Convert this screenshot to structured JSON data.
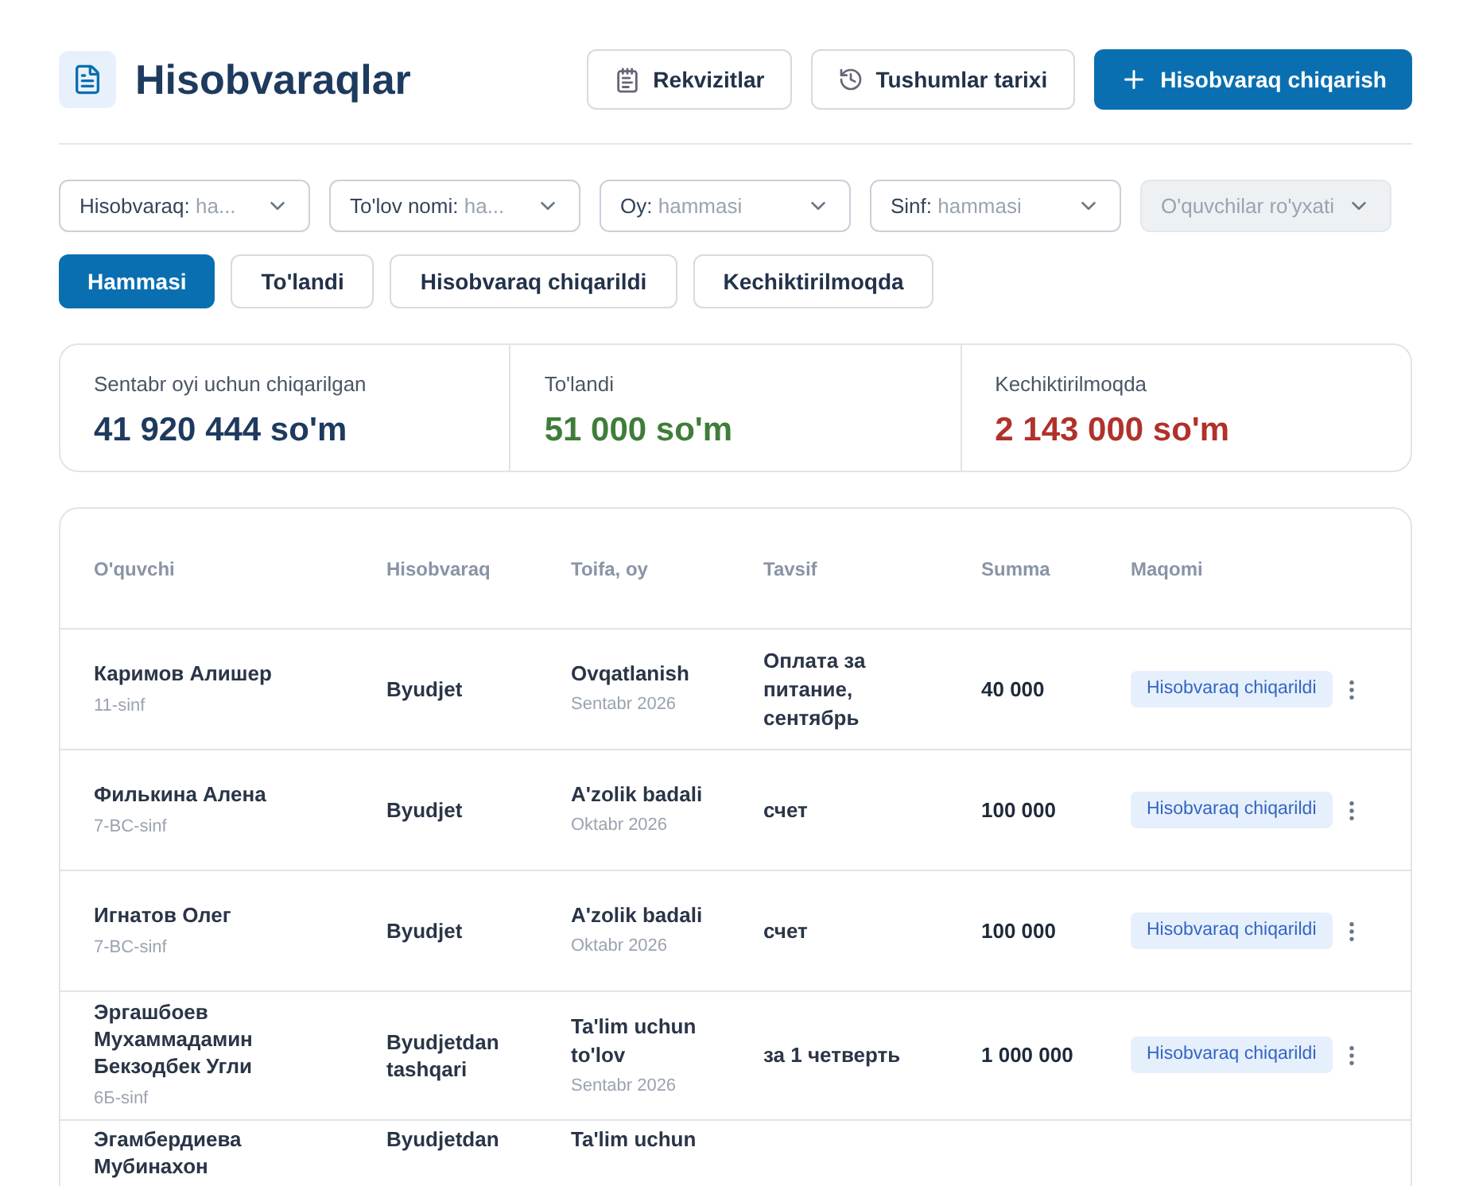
{
  "header": {
    "title": "Hisobvaraqlar",
    "buttons": [
      {
        "label": "Rekvizitlar",
        "kind": "requisites"
      },
      {
        "label": "Tushumlar tarixi",
        "kind": "history"
      },
      {
        "label": "Hisobvaraq chiqarish",
        "kind": "primary"
      }
    ]
  },
  "filters": [
    {
      "label": "Hisobvaraq:",
      "value": "ha...",
      "disabled": false
    },
    {
      "label": "To'lov nomi:",
      "value": "ha...",
      "disabled": false
    },
    {
      "label": "Oy:",
      "value": "hammasi",
      "disabled": false
    },
    {
      "label": "Sinf:",
      "value": "hammasi",
      "disabled": false
    },
    {
      "placeholder": "O'quvchilar ro'yxati",
      "disabled": true
    }
  ],
  "tabs": [
    {
      "label": "Hammasi",
      "selected": true
    },
    {
      "label": "To'landi",
      "selected": false
    },
    {
      "label": "Hisobvaraq chiqarildi",
      "selected": false
    },
    {
      "label": "Kechiktirilmoqda",
      "selected": false
    }
  ],
  "stats": [
    {
      "label": "Sentabr oyi uchun chiqarilgan",
      "value": "41 920 444 so'm",
      "color": "#1e3a5f"
    },
    {
      "label": "To'landi",
      "value": "51 000 so'm",
      "color": "#3f7d3a"
    },
    {
      "label": "Kechiktirilmoqda",
      "value": "2 143 000 so'm",
      "color": "#b0322b"
    }
  ],
  "table": {
    "columns": [
      "O'quvchi",
      "Hisobvaraq",
      "Toifa, oy",
      "Tavsif",
      "Summa",
      "Maqomi"
    ],
    "rows": [
      {
        "student": "Каримов Алишер",
        "class": "11-sinf",
        "invoice": "Byudjet",
        "category": "Ovqatlanish",
        "month": "Sentabr 2026",
        "description": "Оплата за питание, сентябрь",
        "amount": "40 000",
        "status": "Hisobvaraq chiqarildi"
      },
      {
        "student": "Филькина Алена",
        "class": "7-BC-sinf",
        "invoice": "Byudjet",
        "category": "A'zolik badali",
        "month": "Oktabr 2026",
        "description": "счет",
        "amount": "100 000",
        "status": "Hisobvaraq chiqarildi"
      },
      {
        "student": "Игнатов Олег",
        "class": "7-BC-sinf",
        "invoice": "Byudjet",
        "category": "A'zolik badali",
        "month": "Oktabr 2026",
        "description": "счет",
        "amount": "100 000",
        "status": "Hisobvaraq chiqarildi"
      },
      {
        "student": "Эргашбоев Мухаммадамин Бекзодбек Угли",
        "class": "6Б-sinf",
        "invoice": "Byudjetdan tashqari",
        "category": "Ta'lim uchun to'lov",
        "month": "Sentabr 2026",
        "description": "за 1 четверть",
        "amount": "1 000 000",
        "status": "Hisobvaraq chiqarildi"
      },
      {
        "student": "Эгамбердиева Мубинахон",
        "invoice": "Byudjetdan",
        "category": "Ta'lim uchun"
      }
    ]
  }
}
